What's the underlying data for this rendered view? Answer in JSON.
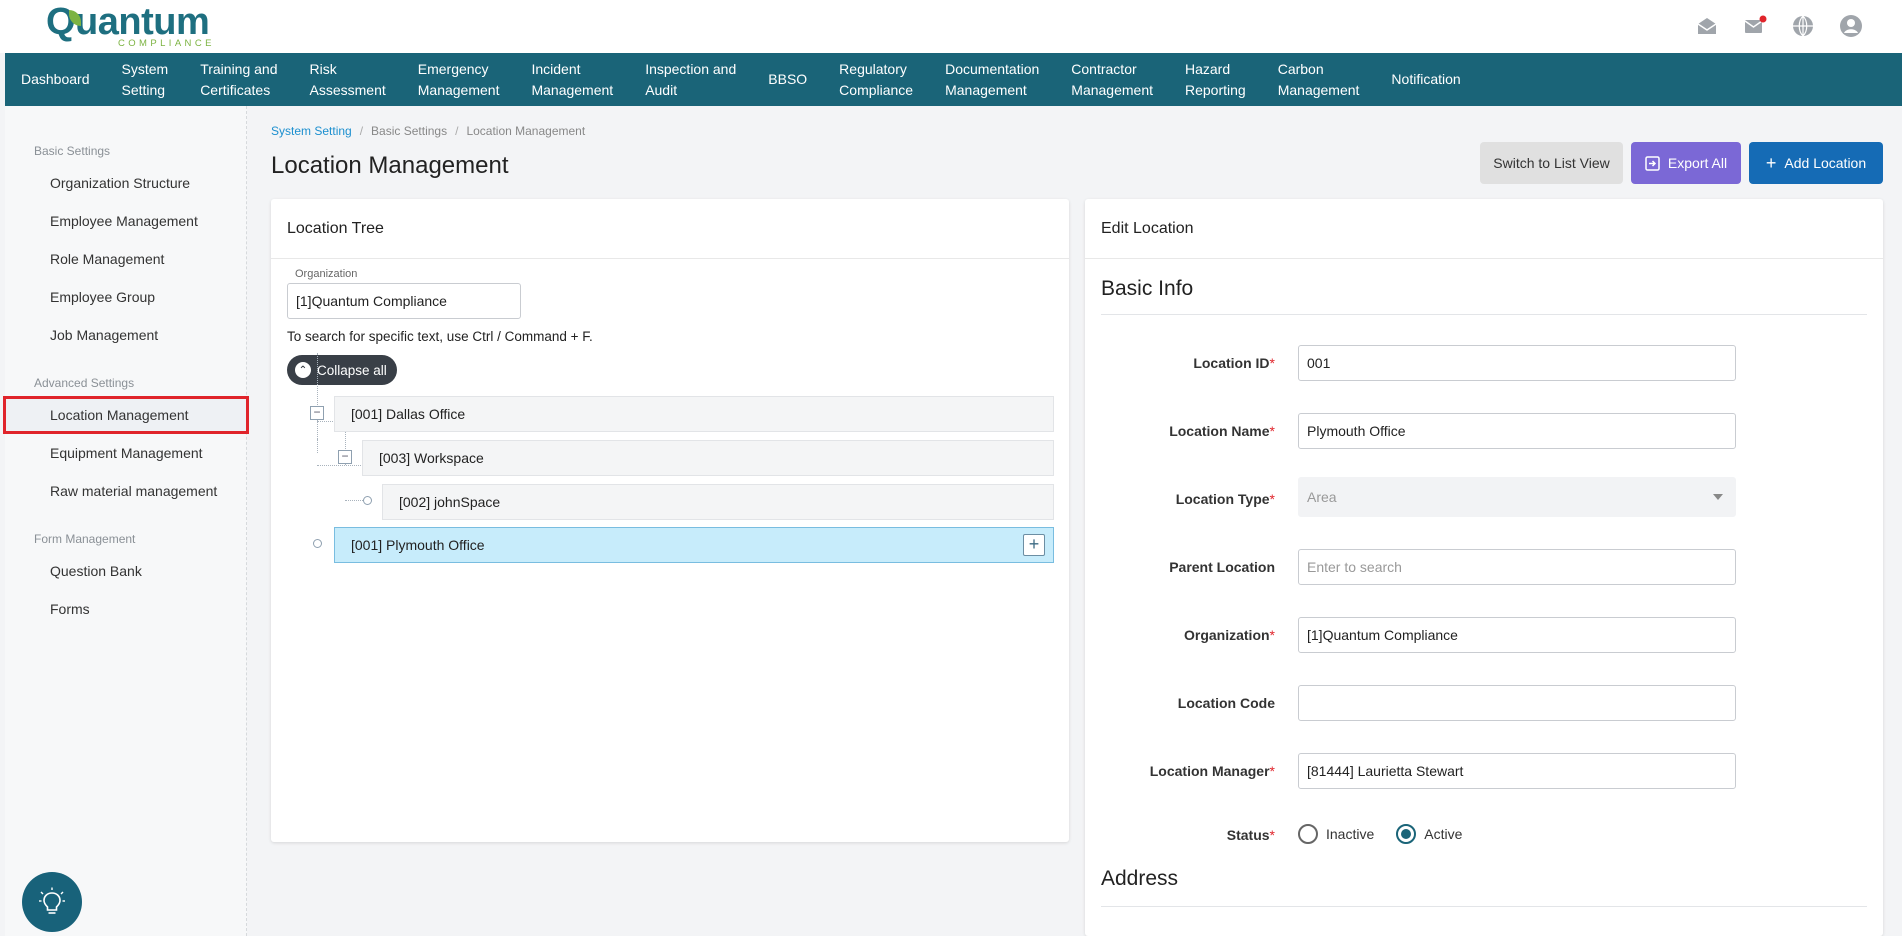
{
  "app": {
    "logo_text": "Quantum",
    "logo_sub": "COMPLIANCE"
  },
  "nav": {
    "items": [
      {
        "line1": "Dashboard",
        "line2": ""
      },
      {
        "line1": "System",
        "line2": "Setting"
      },
      {
        "line1": "Training and",
        "line2": "Certificates"
      },
      {
        "line1": "Risk",
        "line2": "Assessment"
      },
      {
        "line1": "Emergency",
        "line2": "Management"
      },
      {
        "line1": "Incident",
        "line2": "Management"
      },
      {
        "line1": "Inspection and",
        "line2": "Audit"
      },
      {
        "line1": "BBSO",
        "line2": ""
      },
      {
        "line1": "Regulatory",
        "line2": "Compliance"
      },
      {
        "line1": "Documentation",
        "line2": "Management"
      },
      {
        "line1": "Contractor",
        "line2": "Management"
      },
      {
        "line1": "Hazard",
        "line2": "Reporting"
      },
      {
        "line1": "Carbon",
        "line2": "Management"
      },
      {
        "line1": "Notification",
        "line2": ""
      }
    ]
  },
  "sidebar": {
    "groups": [
      {
        "title": "Basic Settings",
        "items": [
          "Organization Structure",
          "Employee Management",
          "Role Management",
          "Employee Group",
          "Job Management"
        ]
      },
      {
        "title": "Advanced Settings",
        "items": [
          "Location Management",
          "Equipment Management",
          "Raw material management"
        ]
      },
      {
        "title": "Form Management",
        "items": [
          "Question Bank",
          "Forms"
        ]
      }
    ],
    "active_item": "Location Management"
  },
  "breadcrumb": {
    "items": [
      "System Setting",
      "Basic Settings",
      "Location Management"
    ]
  },
  "page": {
    "title": "Location Management"
  },
  "actions": {
    "switch_view": "Switch to List View",
    "export_all": "Export All",
    "add_location": "Add Location"
  },
  "tree": {
    "title": "Location Tree",
    "org_label": "Organization",
    "org_value": "[1]Quantum Compliance",
    "hint": "To search for specific text, use Ctrl / Command + F.",
    "collapse_label": "Collapse all",
    "nodes": [
      {
        "label": "[001] Dallas Office"
      },
      {
        "label": "[003] Workspace"
      },
      {
        "label": "[002] johnSpace"
      },
      {
        "label": "[001] Plymouth Office"
      }
    ]
  },
  "edit": {
    "title": "Edit Location",
    "basic_info": "Basic Info",
    "address": "Address",
    "fields": {
      "location_id": {
        "label": "Location ID",
        "value": "001"
      },
      "location_name": {
        "label": "Location Name",
        "value": "Plymouth Office"
      },
      "location_type": {
        "label": "Location Type",
        "value": "Area"
      },
      "parent_location": {
        "label": "Parent Location",
        "placeholder": "Enter to search"
      },
      "organization": {
        "label": "Organization",
        "value": "[1]Quantum Compliance"
      },
      "location_code": {
        "label": "Location Code",
        "value": ""
      },
      "location_manager": {
        "label": "Location Manager",
        "value": "[81444]  Laurietta Stewart"
      },
      "status": {
        "label": "Status",
        "options": [
          "Inactive",
          "Active"
        ],
        "selected": "Active"
      }
    },
    "required_mark": "*"
  },
  "colors": {
    "nav_bg": "#1a6478",
    "brand": "#1e6f80",
    "accent_green": "#7cb342",
    "export_btn": "#7b68d6",
    "add_btn": "#156bb5",
    "selected_node": "#c7ecfb",
    "active_highlight": "#e0242b"
  }
}
